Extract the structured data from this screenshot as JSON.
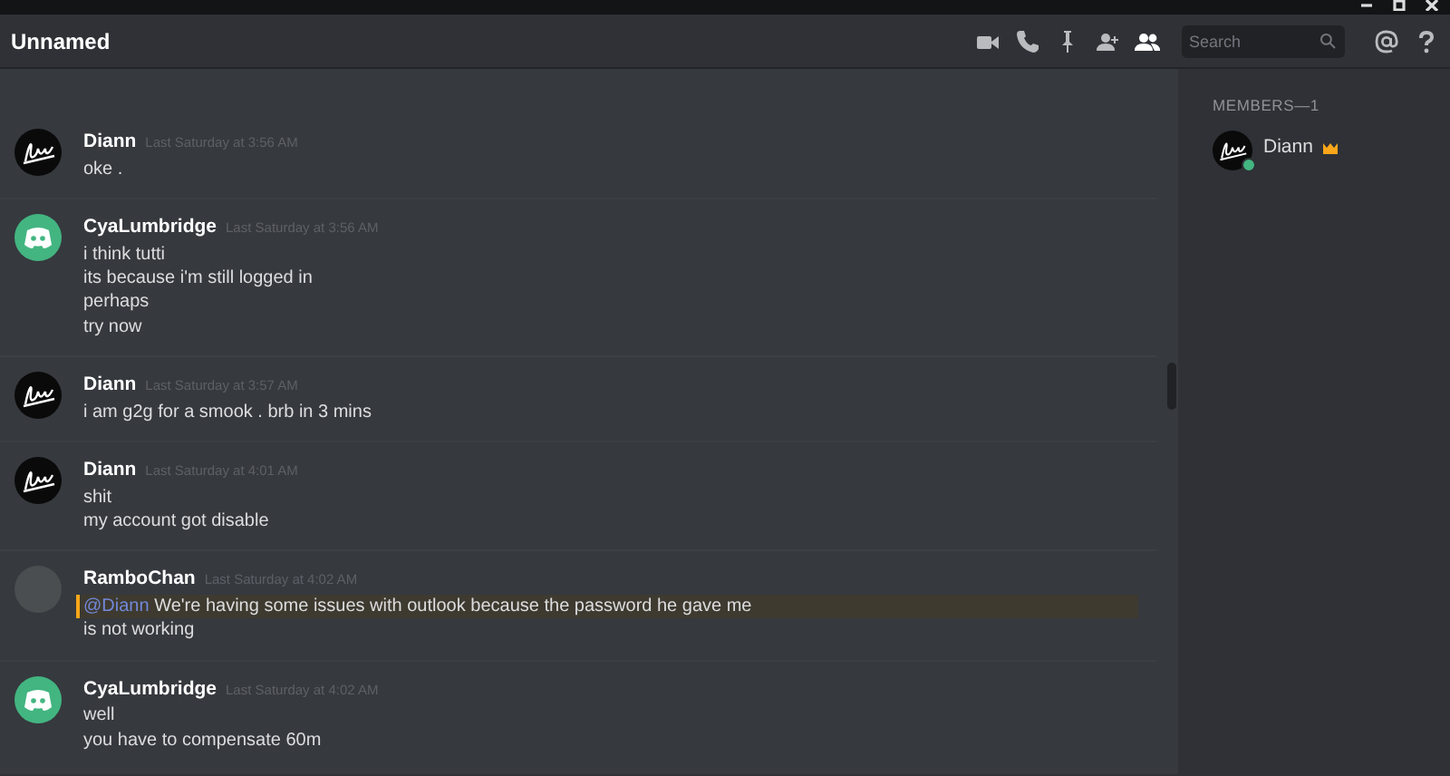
{
  "window": {
    "title": "Unnamed"
  },
  "header_search": {
    "placeholder": "Search"
  },
  "messages": [
    {
      "author": "Diann",
      "kind": "script",
      "time": "Last Saturday at 3:56 AM",
      "lines": [
        {
          "text": "oke ."
        }
      ]
    },
    {
      "author": "CyaLumbridge",
      "kind": "discord",
      "time": "Last Saturday at 3:56 AM",
      "lines": [
        {
          "text": "i think tutti"
        },
        {
          "text": "its because i'm still logged in"
        },
        {
          "text": "perhaps"
        },
        {
          "text": "try now"
        }
      ]
    },
    {
      "author": "Diann",
      "kind": "script",
      "time": "Last Saturday at 3:57 AM",
      "lines": [
        {
          "text": "i am g2g for a smook . brb in 3 mins"
        }
      ]
    },
    {
      "author": "Diann",
      "kind": "script",
      "time": "Last Saturday at 4:01 AM",
      "lines": [
        {
          "text": "shit"
        },
        {
          "text": "my account got disable"
        }
      ]
    },
    {
      "author": "RamboChan",
      "kind": "photo",
      "time": "Last Saturday at 4:02 AM",
      "lines": [
        {
          "mention": "@Diann",
          "text": "We're having some issues with outlook because the password he gave me",
          "highlighted": true
        },
        {
          "text": "is not working"
        }
      ]
    },
    {
      "author": "CyaLumbridge",
      "kind": "discord",
      "time": "Last Saturday at 4:02 AM",
      "lines": [
        {
          "text": "well"
        },
        {
          "text": "you have to compensate 60m"
        }
      ]
    }
  ],
  "members": {
    "heading": "MEMBERS—1",
    "items": [
      {
        "name": "Diann",
        "kind": "script",
        "online": true,
        "owner": true
      }
    ]
  }
}
